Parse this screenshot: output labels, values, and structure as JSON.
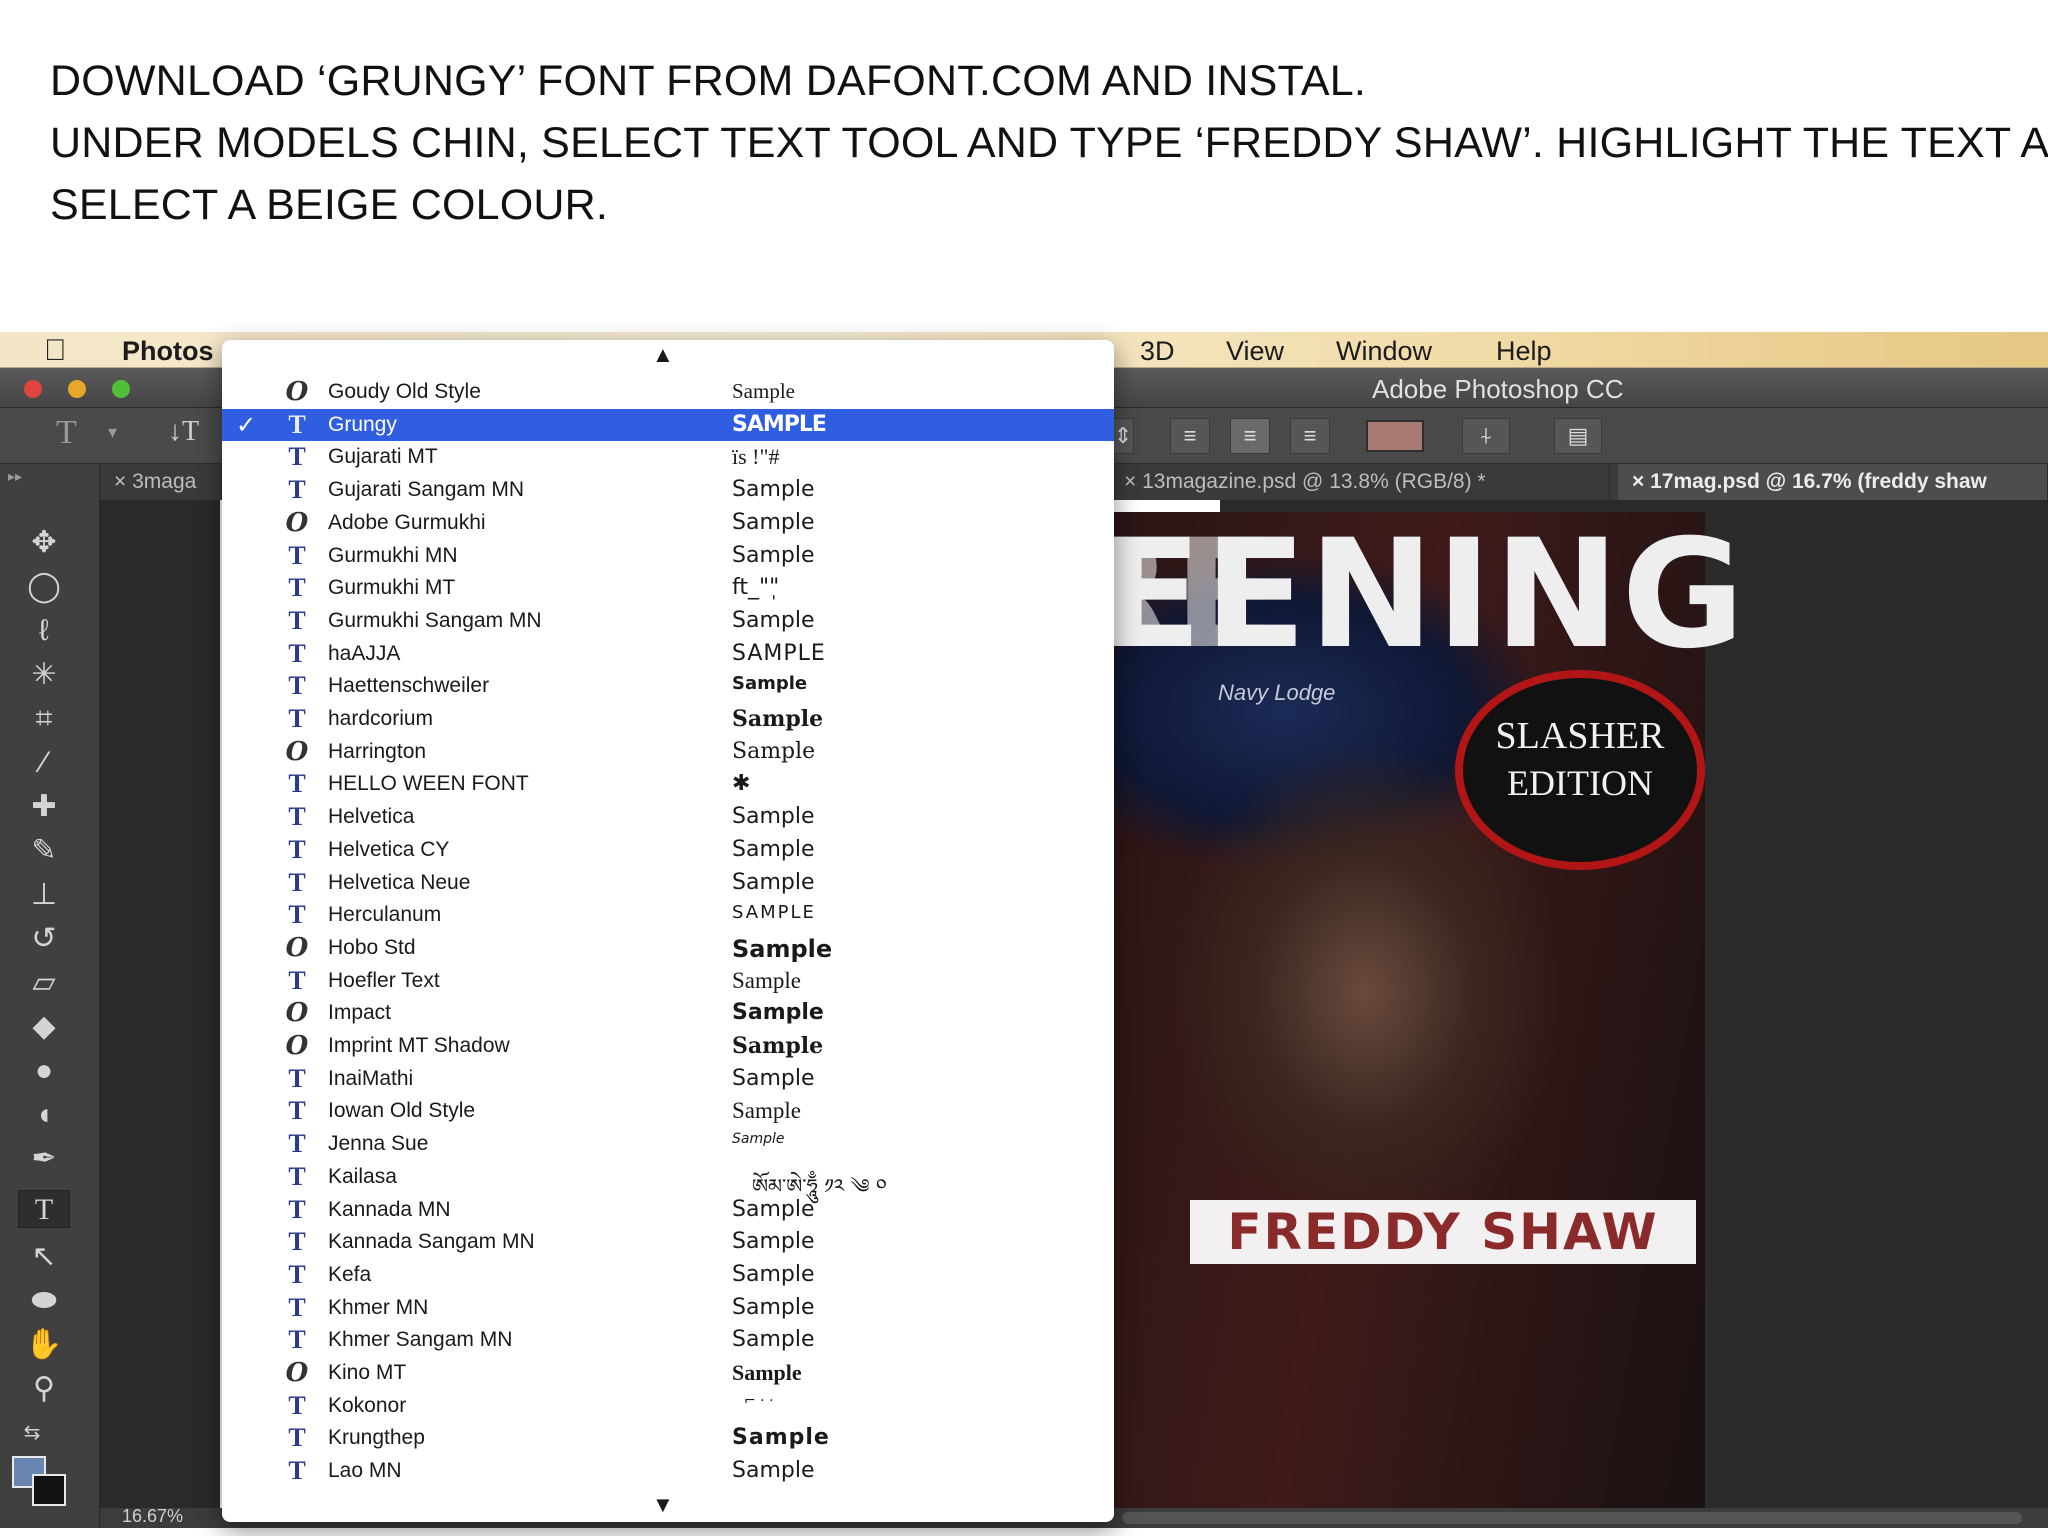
{
  "instructions": {
    "line1": "DOWNLOAD ‘GRUNGY’ FONT FROM DAFONT.COM AND INSTAL.",
    "line2": "UNDER MODELS CHIN, SELECT TEXT TOOL AND TYPE ‘FREDDY SHAW’. HIGHLIGHT THE TEXT AND",
    "line3": "SELECT A BEIGE COLOUR."
  },
  "menubar": {
    "app_name": "Photos",
    "items": [
      "3D",
      "View",
      "Window",
      "Help"
    ]
  },
  "window": {
    "title": "Adobe Photoshop CC"
  },
  "tabs": [
    {
      "label": "× 3maga"
    },
    {
      "label": "× 13magazine.psd @ 13.8% (RGB/8) *"
    },
    {
      "label": "× 17mag.psd @ 16.7% (freddy shaw"
    }
  ],
  "options_bar": {
    "tool_glyph": "T",
    "orient_glyph": "↓T"
  },
  "canvas": {
    "headline": "SCREENING",
    "headline_ghost": "SCRE",
    "cap_text": "Navy   Lodge",
    "badge_line1": "SLASHER",
    "badge_line2": "EDITION",
    "name_text": "FREDDY SHAW"
  },
  "status": {
    "zoom": "16.67%"
  },
  "font_menu": {
    "selected": "Grungy",
    "fonts": [
      {
        "name": "Goudy Old Style",
        "sample": "Sample",
        "icon": "opentype-icon"
      },
      {
        "name": "Grungy",
        "sample": "SAMPLE",
        "icon": "truetype-icon"
      },
      {
        "name": "Gujarati MT",
        "sample": "ïs  !\"#",
        "icon": "truetype-icon"
      },
      {
        "name": "Gujarati Sangam MN",
        "sample": "Sample",
        "icon": "truetype-icon"
      },
      {
        "name": "Adobe Gurmukhi",
        "sample": "Sample",
        "icon": "opentype-icon"
      },
      {
        "name": "Gurmukhi MN",
        "sample": "Sample",
        "icon": "truetype-icon"
      },
      {
        "name": "Gurmukhi MT",
        "sample": "ft_\"\"̩",
        "icon": "truetype-icon"
      },
      {
        "name": "Gurmukhi Sangam MN",
        "sample": "Sample",
        "icon": "truetype-icon"
      },
      {
        "name": "haAJJA",
        "sample": "SAMPLE",
        "icon": "truetype-icon"
      },
      {
        "name": "Haettenschweiler",
        "sample": "Sample",
        "icon": "truetype-icon"
      },
      {
        "name": "hardcorium",
        "sample": "Sample",
        "icon": "truetype-icon"
      },
      {
        "name": "Harrington",
        "sample": "Sample",
        "icon": "opentype-icon"
      },
      {
        "name": "HELLO WEEN FONT",
        "sample": "✱",
        "icon": "truetype-icon"
      },
      {
        "name": "Helvetica",
        "sample": "Sample",
        "icon": "truetype-icon"
      },
      {
        "name": "Helvetica CY",
        "sample": "Sample",
        "icon": "truetype-icon"
      },
      {
        "name": "Helvetica Neue",
        "sample": "Sample",
        "icon": "truetype-icon"
      },
      {
        "name": "Herculanum",
        "sample": "SAMPLE",
        "icon": "truetype-icon"
      },
      {
        "name": "Hobo Std",
        "sample": "Sample",
        "icon": "opentype-icon"
      },
      {
        "name": "Hoefler Text",
        "sample": "Sample",
        "icon": "truetype-icon"
      },
      {
        "name": "Impact",
        "sample": "Sample",
        "icon": "opentype-icon"
      },
      {
        "name": "Imprint MT Shadow",
        "sample": "Sample",
        "icon": "opentype-icon"
      },
      {
        "name": "InaiMathi",
        "sample": "Sample",
        "icon": "truetype-icon"
      },
      {
        "name": "Iowan Old Style",
        "sample": "Sample",
        "icon": "truetype-icon"
      },
      {
        "name": "Jenna Sue",
        "sample": "Sample",
        "icon": "truetype-icon"
      },
      {
        "name": "Kailasa",
        "sample": "ཨོམ་ཨེ་ཧཱུྃ ༡༢ ༄ ༠",
        "icon": "truetype-icon"
      },
      {
        "name": "Kannada MN",
        "sample": "Sample",
        "icon": "truetype-icon"
      },
      {
        "name": "Kannada Sangam MN",
        "sample": "Sample",
        "icon": "truetype-icon"
      },
      {
        "name": "Kefa",
        "sample": "Sample",
        "icon": "truetype-icon"
      },
      {
        "name": "Khmer MN",
        "sample": "Sample",
        "icon": "truetype-icon"
      },
      {
        "name": "Khmer Sangam MN",
        "sample": "Sample",
        "icon": "truetype-icon"
      },
      {
        "name": "Kino MT",
        "sample": "Sample",
        "icon": "opentype-icon"
      },
      {
        "name": "Kokonor",
        "sample": "⌐ · ·",
        "icon": "truetype-icon"
      },
      {
        "name": "Krungthep",
        "sample": "Sample",
        "icon": "truetype-icon"
      },
      {
        "name": "Lao MN",
        "sample": "Sample",
        "icon": "truetype-icon"
      }
    ]
  },
  "colors": {
    "selection": "#2f5fe0",
    "text_color_swatch": "#a77a73",
    "foreground_color": "#6b86b3",
    "background_color": "#111111"
  }
}
